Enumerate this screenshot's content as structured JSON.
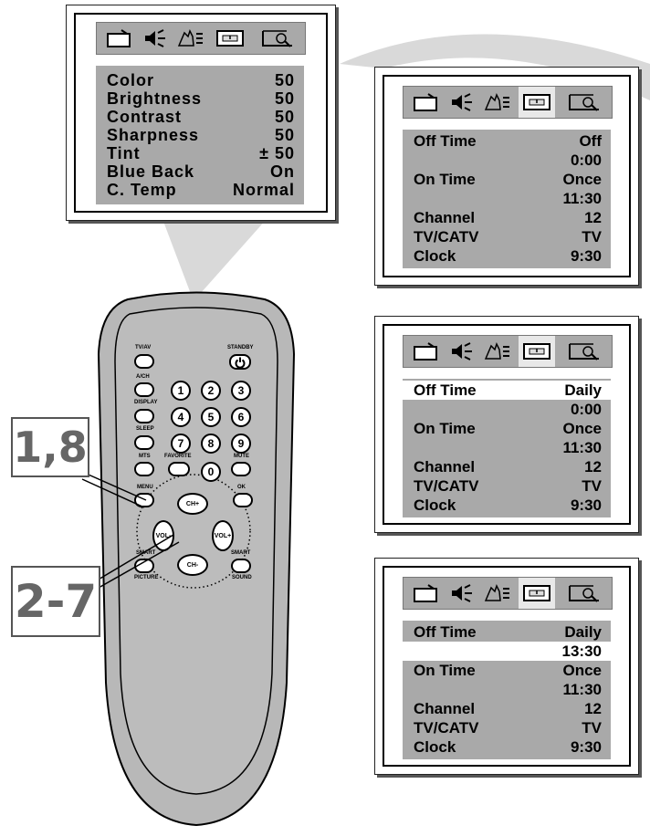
{
  "picture_menu": {
    "items": [
      {
        "label": "Color",
        "value": "50"
      },
      {
        "label": "Brightness",
        "value": "50"
      },
      {
        "label": "Contrast",
        "value": "50"
      },
      {
        "label": "Sharpness",
        "value": "50"
      },
      {
        "label": "Tint",
        "value": "± 50"
      },
      {
        "label": "Blue Back",
        "value": "On"
      },
      {
        "label": "C. Temp",
        "value": "Normal"
      }
    ]
  },
  "timer_menu_1": {
    "rows": [
      {
        "label": "Off Time",
        "value": "Off"
      },
      {
        "label": "",
        "value": "0:00"
      },
      {
        "label": "On Time",
        "value": "Once"
      },
      {
        "label": "",
        "value": "11:30"
      },
      {
        "label": "Channel",
        "value": "12"
      },
      {
        "label": "TV/CATV",
        "value": "TV"
      },
      {
        "label": "Clock",
        "value": "9:30"
      }
    ]
  },
  "timer_menu_2": {
    "rows": [
      {
        "label": "Off Time",
        "value": "Daily"
      },
      {
        "label": "",
        "value": "0:00"
      },
      {
        "label": "On Time",
        "value": "Once"
      },
      {
        "label": "",
        "value": "11:30"
      },
      {
        "label": "Channel",
        "value": "12"
      },
      {
        "label": "TV/CATV",
        "value": "TV"
      },
      {
        "label": "Clock",
        "value": "9:30"
      }
    ]
  },
  "timer_menu_3": {
    "rows": [
      {
        "label": "Off Time",
        "value": "Daily"
      },
      {
        "label": "",
        "value": "13:30"
      },
      {
        "label": "On Time",
        "value": "Once"
      },
      {
        "label": "",
        "value": "11:30"
      },
      {
        "label": "Channel",
        "value": "12"
      },
      {
        "label": "TV/CATV",
        "value": "TV"
      },
      {
        "label": "Clock",
        "value": "9:30"
      }
    ]
  },
  "callouts": {
    "step_a": "1,8",
    "step_b": "2-7"
  },
  "remote": {
    "tvav": "TV/AV",
    "standby": "STANDBY",
    "ach": "A/CH",
    "display": "DISPLAY",
    "sleep": "SLEEP",
    "mts": "MTS",
    "favorite": "FAVORITE",
    "mute": "MUTE",
    "menu": "MENU",
    "ok": "OK",
    "smart_left": "SMART",
    "picture": "PICTURE",
    "smart_right": "SMART",
    "sound": "SOUND",
    "chplus": "CH+",
    "chminus": "CH-",
    "volminus": "VOL-",
    "volplus": "VOL+",
    "digits": [
      "1",
      "2",
      "3",
      "4",
      "5",
      "6",
      "7",
      "8",
      "9",
      "0"
    ]
  },
  "icons": [
    "tv-icon",
    "speaker-icon",
    "hand-settings-icon",
    "timer-icon",
    "screen-magnify-icon"
  ]
}
